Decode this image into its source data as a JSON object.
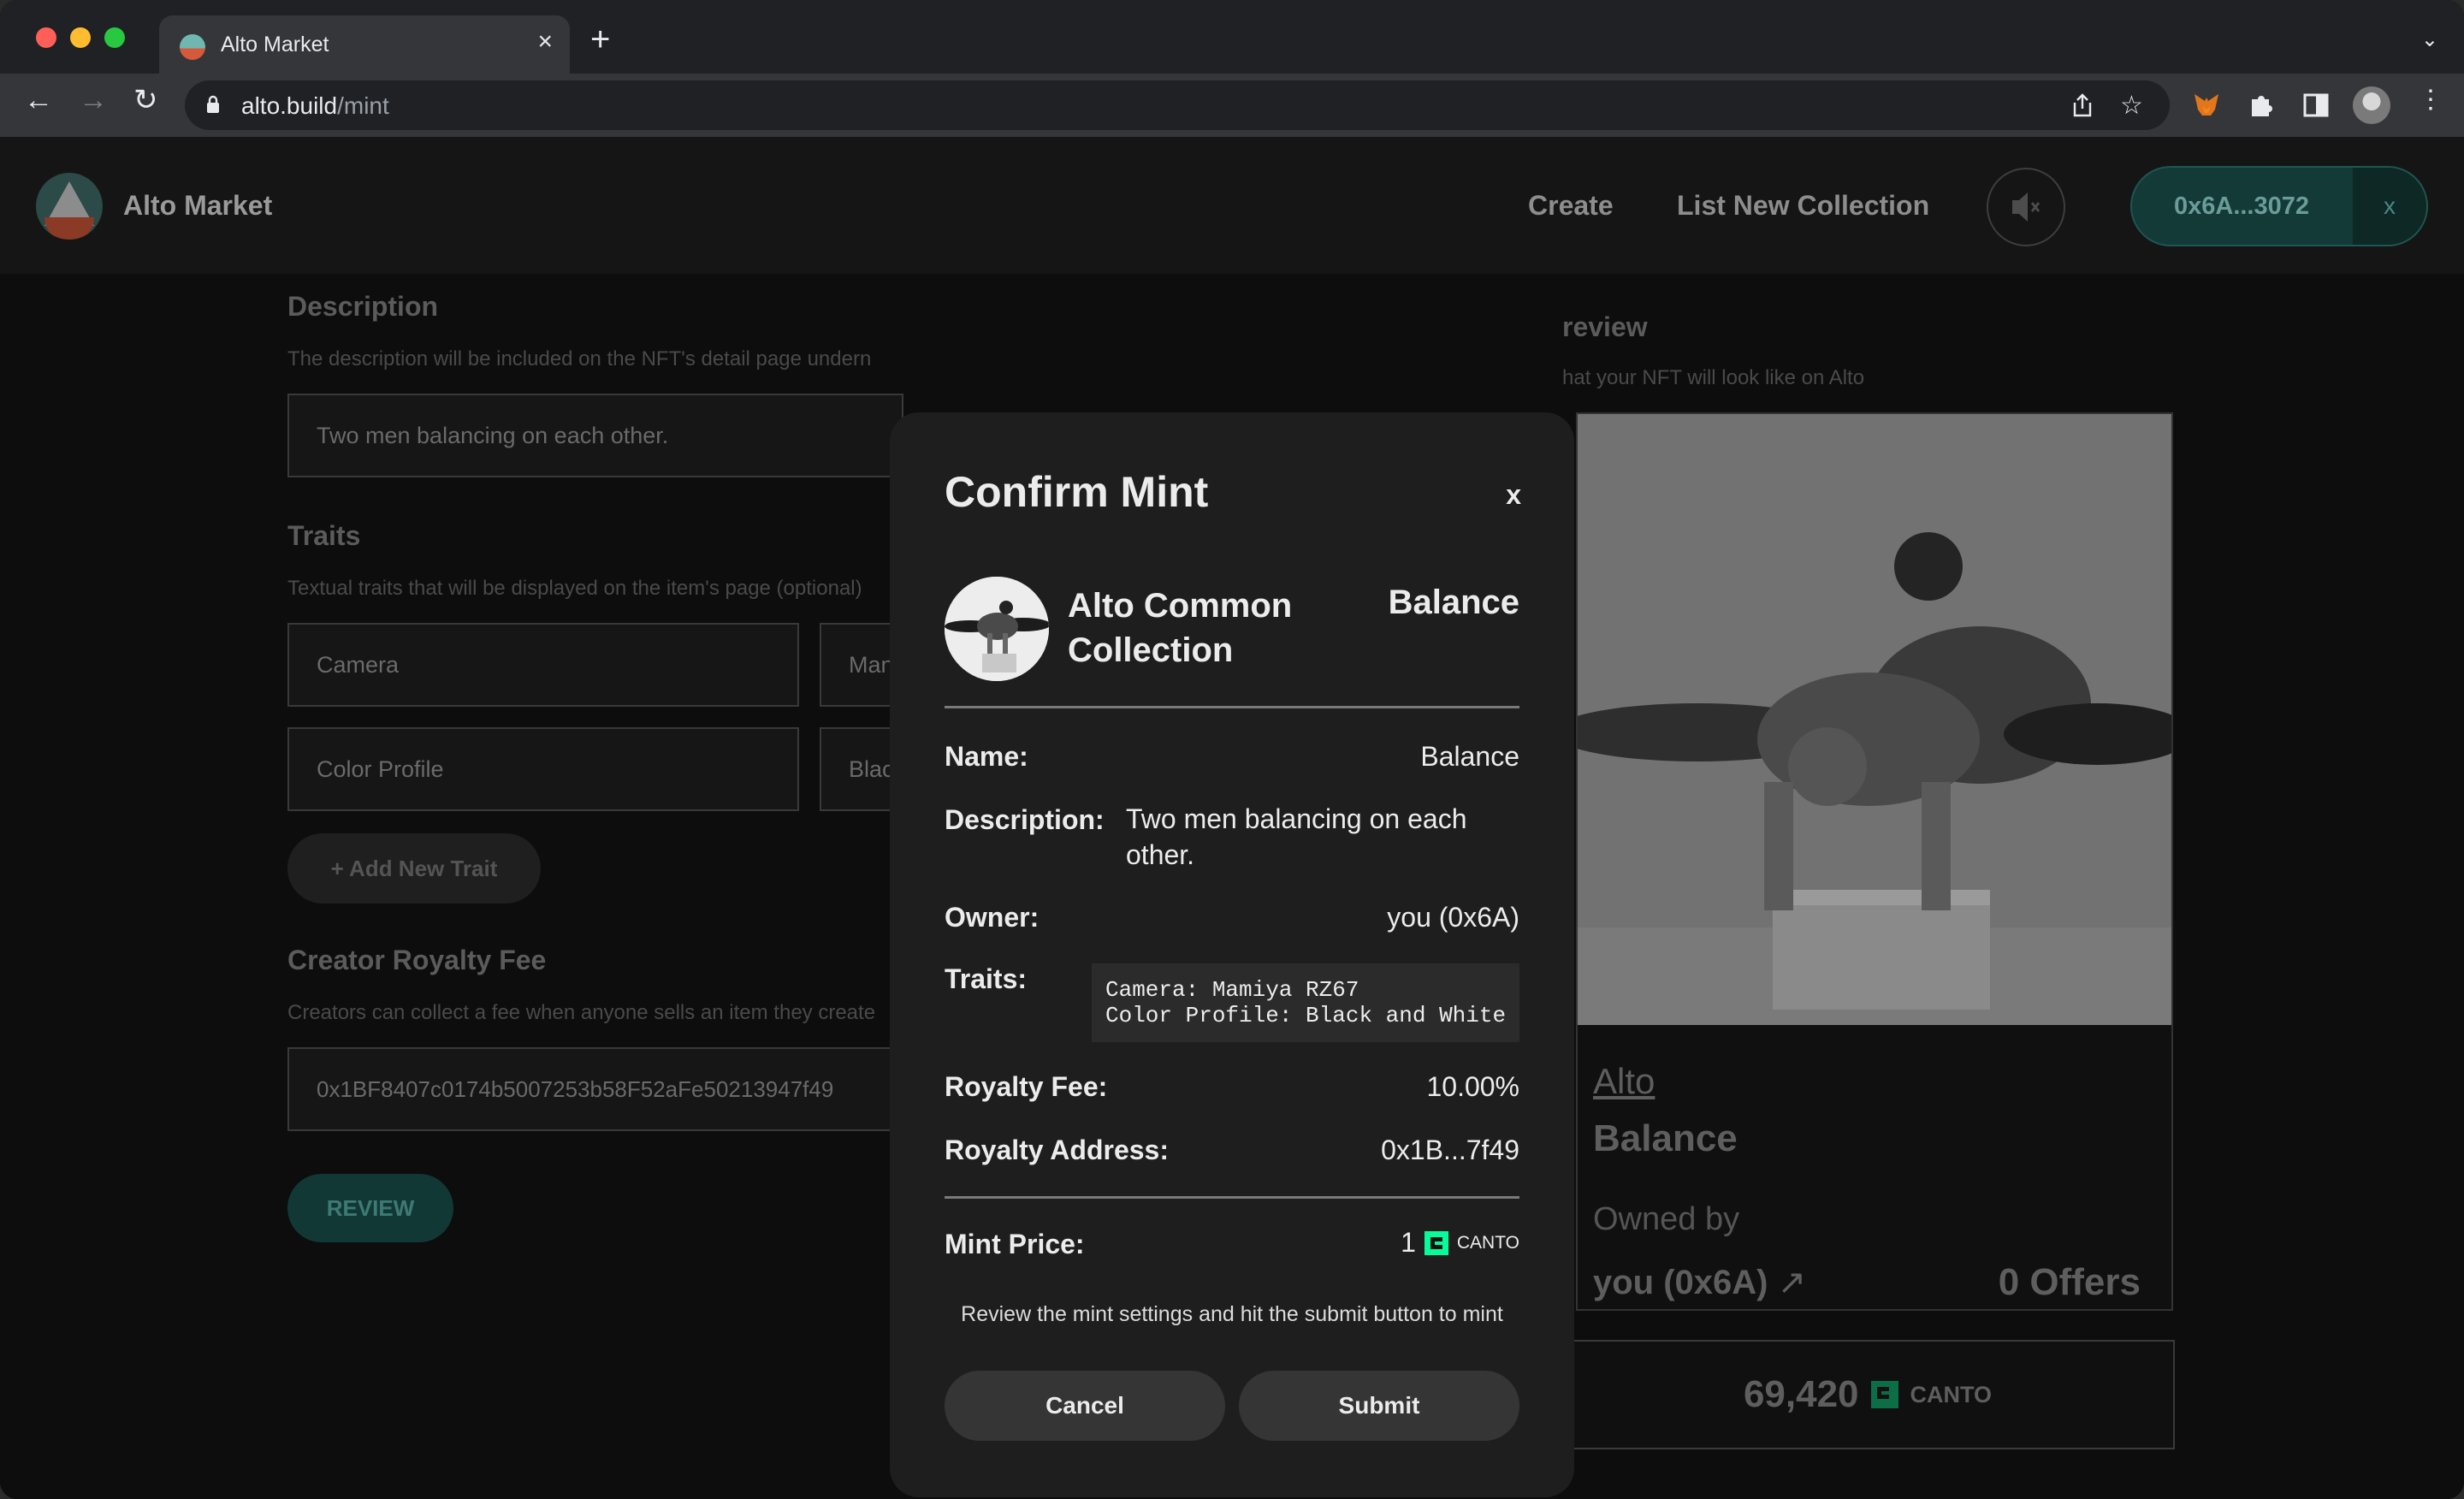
{
  "browser": {
    "tab_title": "Alto Market",
    "tab_close": "×",
    "new_tab": "+",
    "url_host": "alto.build",
    "url_path": "/mint"
  },
  "header": {
    "brand": "Alto Market",
    "nav": [
      "Create",
      "List New Collection"
    ],
    "wallet_address": "0x6A...3072",
    "wallet_close": "x"
  },
  "form": {
    "description": {
      "title": "Description",
      "hint": "The description will be included on the NFT's detail page undern",
      "value": "Two men balancing on each other."
    },
    "traits": {
      "title": "Traits",
      "hint": "Textual traits that will be displayed on the item's page (optional)",
      "rows": [
        {
          "key": "Camera",
          "value": "Man"
        },
        {
          "key": "Color Profile",
          "value": "Blac"
        }
      ],
      "add_label": "+ Add New Trait"
    },
    "royalty": {
      "title": "Creator Royalty Fee",
      "hint": "Creators can collect a fee when anyone sells an item they create",
      "address": "0x1BF8407c0174b5007253b58F52aFe50213947f49"
    },
    "review_label": "REVIEW"
  },
  "preview": {
    "title": "review",
    "hint": "hat your NFT will look like on Alto",
    "collection": "Alto",
    "name": "Balance",
    "owned_by_label": "Owned by",
    "owner": "you (0x6A)",
    "owner_arrow": "↗",
    "offers": "0 Offers",
    "price": "69,420",
    "currency": "CANTO"
  },
  "modal": {
    "title": "Confirm Mint",
    "close": "x",
    "collection": "Alto Common Collection",
    "item_name": "Balance",
    "name_label": "Name:",
    "name_value": "Balance",
    "description_label": "Description:",
    "description_value": "Two men balancing on each other.",
    "owner_label": "Owner:",
    "owner_value": "you (0x6A)",
    "traits_label": "Traits:",
    "traits_value": "Camera: Mamiya RZ67\nColor Profile: Black and White",
    "royalty_fee_label": "Royalty Fee:",
    "royalty_fee_value": "10.00%",
    "royalty_address_label": "Royalty Address:",
    "royalty_address_value": "0x1B...7f49",
    "mint_price_label": "Mint Price:",
    "mint_price_value": "1",
    "mint_currency": "CANTO",
    "note": "Review the mint settings and hit the submit button to mint",
    "cancel_label": "Cancel",
    "submit_label": "Submit"
  },
  "colors": {
    "accent": "#06fc99",
    "wallet_bg": "#143a38",
    "modal_bg": "#1e1e1e"
  }
}
